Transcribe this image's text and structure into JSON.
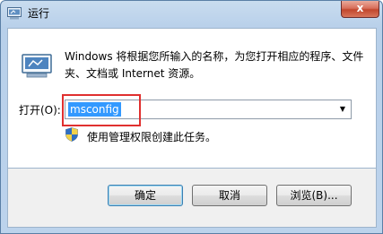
{
  "window": {
    "title": "运行",
    "close_glyph": "x"
  },
  "main": {
    "description": "Windows 将根据您所输入的名称，为您打开相应的程序、文件夹、文档或 Internet 资源。",
    "open_label": "打开(O):",
    "command_value": "msconfig",
    "admin_note": "使用管理权限创建此任务。"
  },
  "buttons": {
    "ok": "确定",
    "cancel": "取消",
    "browse": "浏览(B)..."
  },
  "icons": {
    "title": "run-icon",
    "app": "run-program-icon",
    "admin": "uac-shield-icon",
    "dropdown": "chevron-down-icon",
    "close": "close-icon"
  },
  "colors": {
    "selection": "#3399ff",
    "highlight_box": "#e0302f",
    "close_button": "#c1462c"
  }
}
